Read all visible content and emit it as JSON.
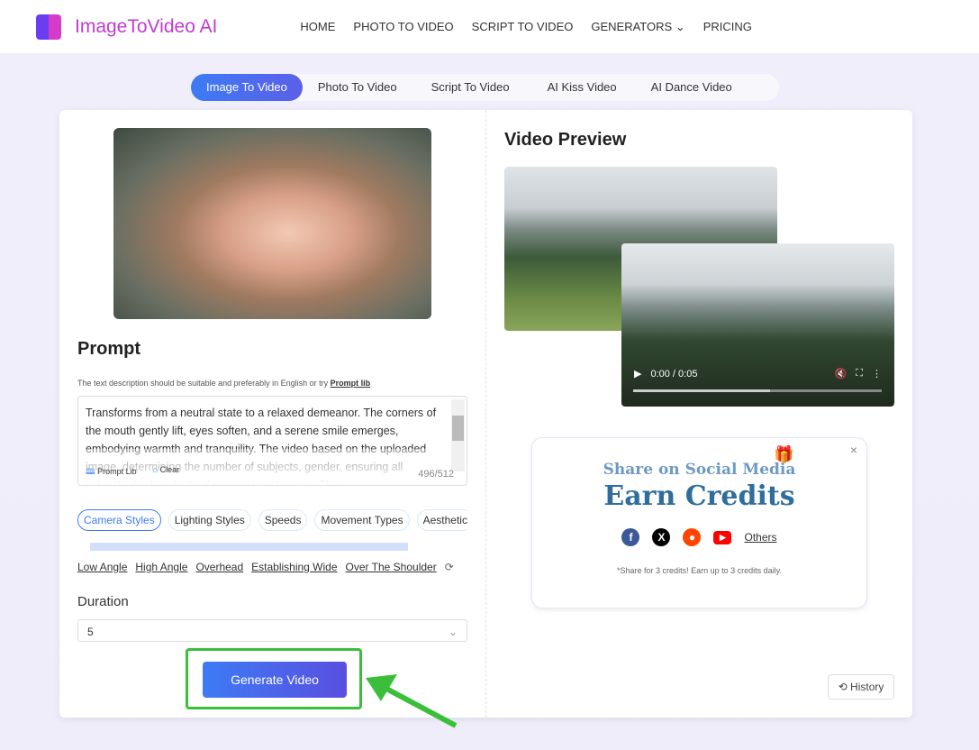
{
  "nav": {
    "brand": "ImageToVideo AI",
    "links": [
      "HOME",
      "PHOTO TO VIDEO",
      "SCRIPT TO VIDEO",
      "GENERATORS",
      "PRICING"
    ]
  },
  "tabs": [
    "Image To Video",
    "Photo To Video",
    "Script To Video",
    "AI Kiss Video",
    "AI Dance Video"
  ],
  "left": {
    "prompt_title": "Prompt",
    "hint": "The text description should be suitable and preferably in English or try",
    "hint_link": "Prompt lib",
    "prompt_text": "Transforms from a neutral state to a relaxed demeanor. The corners of the mouth gently lift, eyes soften, and a serene smile emerges, embodying warmth and tranquility. The video  based on the uploaded image, determining the number of subjects, gender, ensuring all subjects display identical expression changes. The",
    "prompt_lib": "Prompt Lib",
    "clear": "Clear",
    "count": "496/512",
    "chips": [
      "Camera Styles",
      "Lighting Styles",
      "Speeds",
      "Movement Types",
      "Aesthetic"
    ],
    "angles": [
      "Low Angle",
      "High Angle",
      "Overhead",
      "Establishing Wide",
      "Over The Shoulder"
    ],
    "duration_label": "Duration",
    "duration_value": "5",
    "generate": "Generate Video"
  },
  "right": {
    "title": "Video Preview",
    "time": "0:00 / 0:05",
    "progress": 0.55,
    "share_title": "Share on Social Media",
    "share_big": "Earn Credits",
    "others": "Others",
    "note": "*Share for 3 credits! Earn up to 3 credits daily.",
    "history": "History"
  },
  "colors": {
    "accent": "#3d7bf5",
    "brand": "#c13ad1",
    "highlight": "#3bbf3b"
  }
}
